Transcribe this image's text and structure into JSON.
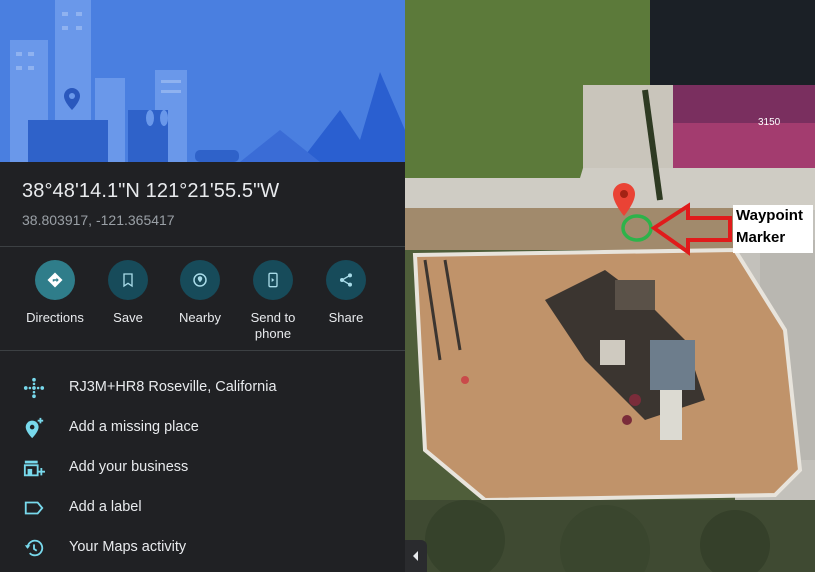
{
  "place": {
    "coordinates_dms": "38°48'14.1\"N 121°21'55.5\"W",
    "coordinates_decimal": "38.803917, -121.365417"
  },
  "actions": [
    {
      "label": "Directions",
      "icon": "directions-icon"
    },
    {
      "label": "Save",
      "icon": "bookmark-icon"
    },
    {
      "label": "Nearby",
      "icon": "nearby-icon"
    },
    {
      "label": "Send to phone",
      "icon": "send-to-phone-icon"
    },
    {
      "label": "Share",
      "icon": "share-icon"
    }
  ],
  "details": [
    {
      "label": "RJ3M+HR8 Roseville, California",
      "icon": "plus-code-icon"
    },
    {
      "label": "Add a missing place",
      "icon": "add-place-icon"
    },
    {
      "label": "Add your business",
      "icon": "add-business-icon"
    },
    {
      "label": "Add a label",
      "icon": "label-icon"
    },
    {
      "label": "Your Maps activity",
      "icon": "history-icon"
    }
  ],
  "map": {
    "building_number": "3150",
    "annotation": {
      "line1": "Waypoint",
      "line2": "Marker"
    }
  },
  "colors": {
    "panel_bg": "#202124",
    "hero_blue": "#4a7fe0",
    "accent_teal": "#8ab4f8",
    "icon_teal": "#78d9ec",
    "pin_red": "#ea4335",
    "annotation_red": "#e01b1b",
    "annotation_green": "#2db34a"
  }
}
